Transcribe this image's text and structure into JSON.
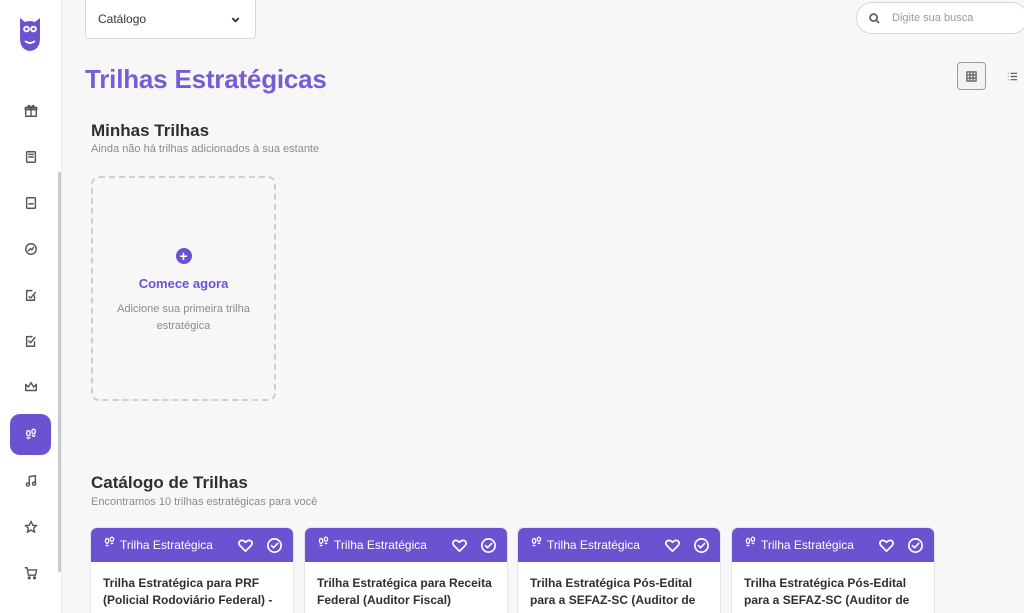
{
  "colors": {
    "accent": "#6c52d1",
    "title": "#7a5bd6"
  },
  "sidebar": {
    "logo_icon": "owl-logo-icon",
    "items": [
      {
        "name": "sidebar-item-gift",
        "icon": "gift-icon",
        "active": false
      },
      {
        "name": "sidebar-item-book",
        "icon": "book-icon",
        "active": false
      },
      {
        "name": "sidebar-item-notebook",
        "icon": "notebook-icon",
        "active": false
      },
      {
        "name": "sidebar-item-gauge",
        "icon": "gauge-icon",
        "active": false
      },
      {
        "name": "sidebar-item-edit-list",
        "icon": "edit-list-icon",
        "active": false
      },
      {
        "name": "sidebar-item-checklist",
        "icon": "checklist-icon",
        "active": false
      },
      {
        "name": "sidebar-item-crown",
        "icon": "crown-icon",
        "active": false
      },
      {
        "name": "sidebar-item-trails",
        "icon": "footprints-icon",
        "active": true
      },
      {
        "name": "sidebar-item-music",
        "icon": "music-icon",
        "active": false
      },
      {
        "name": "sidebar-item-favorites",
        "icon": "star-icon",
        "active": false
      },
      {
        "name": "sidebar-item-cart",
        "icon": "cart-icon",
        "active": false
      }
    ]
  },
  "header": {
    "catalog_select": "Catálogo",
    "search_placeholder": "Digite sua busca"
  },
  "page": {
    "title": "Trilhas Estratégicas"
  },
  "my_trails": {
    "title": "Minhas Trilhas",
    "subtitle": "Ainda não há trilhas adicionados à sua estante",
    "empty_cta": "Comece agora",
    "empty_hint": "Adicione sua primeira trilha estratégica"
  },
  "catalog": {
    "title": "Catálogo de Trilhas",
    "subtitle": "Encontramos 10 trilhas estratégicas para você",
    "cards": [
      {
        "tag": "Trilha Estratégica",
        "title": "Trilha Estratégica para PRF (Policial Rodoviário Federal) -"
      },
      {
        "tag": "Trilha Estratégica",
        "title": "Trilha Estratégica para Receita Federal (Auditor Fiscal)"
      },
      {
        "tag": "Trilha Estratégica",
        "title": "Trilha Estratégica Pós-Edital para a SEFAZ-SC (Auditor de"
      },
      {
        "tag": "Trilha Estratégica",
        "title": "Trilha Estratégica Pós-Edital para a SEFAZ-SC (Auditor de"
      }
    ]
  }
}
